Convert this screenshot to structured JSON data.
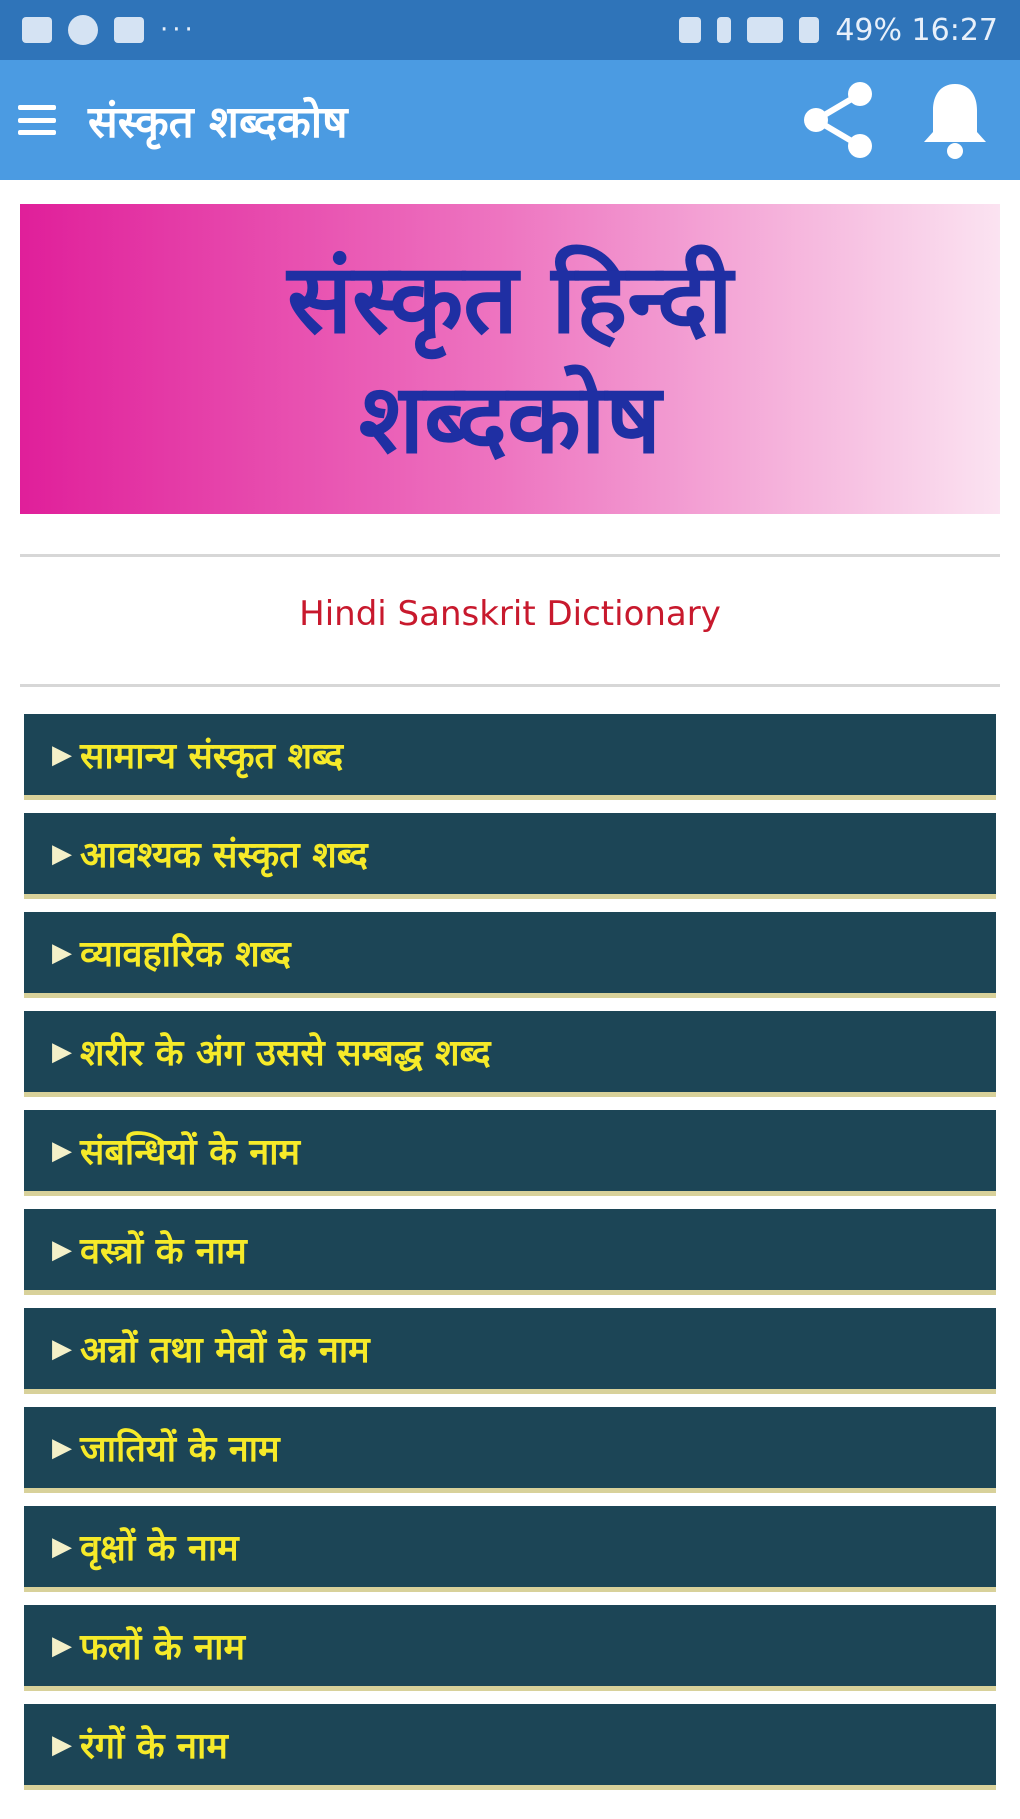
{
  "status_bar": {
    "dots": "···",
    "text": "49% 16:27"
  },
  "app_bar": {
    "title": "संस्कृत शब्दकोष",
    "icons": [
      "menu-icon",
      "share-icon",
      "bell-icon"
    ]
  },
  "banner": {
    "line1": "संस्कृत हिन्दी",
    "line2": "शब्दकोष"
  },
  "subtitle": "Hindi Sanskrit Dictionary",
  "colors": {
    "status_bar": "#2f74b9",
    "app_bar": "#4b9be2",
    "menu_item_bg": "#1c4556",
    "menu_item_text": "#f6ea29",
    "subtitle": "#c8192d",
    "banner_text": "#1f2fa3"
  },
  "menu": {
    "arrow": "▶",
    "items": [
      {
        "label": "सामान्य संस्कृत शब्द"
      },
      {
        "label": "आवश्यक संस्कृत शब्द"
      },
      {
        "label": "व्यावहारिक शब्द"
      },
      {
        "label": "शरीर के अंग उससे सम्बद्ध शब्द"
      },
      {
        "label": "संबन्धियों के नाम"
      },
      {
        "label": "वस्त्रों के नाम"
      },
      {
        "label": "अन्नों तथा मेवों के नाम"
      },
      {
        "label": "जातियों के नाम"
      },
      {
        "label": "वृक्षों के नाम"
      },
      {
        "label": "फलों के नाम"
      },
      {
        "label": "रंगों के नाम"
      }
    ]
  }
}
